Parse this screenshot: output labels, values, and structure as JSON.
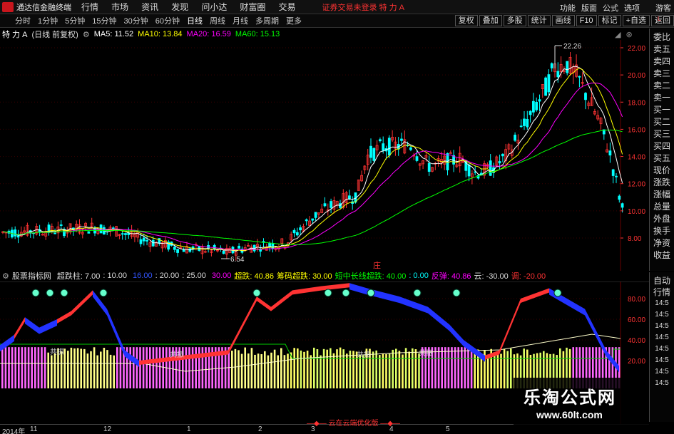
{
  "titlebar": {
    "app_title": "通达信金融终端",
    "menu": [
      "行情",
      "市场",
      "资讯",
      "发现",
      "问小达",
      "财富圈",
      "交易"
    ],
    "alert": "证券交易未登录 特 力 A",
    "right": [
      "功能",
      "版面",
      "公式",
      "选项",
      "游客"
    ]
  },
  "tabbar": {
    "tabs": [
      "分时",
      "1分钟",
      "5分钟",
      "15分钟",
      "30分钟",
      "60分钟",
      "日线",
      "周线",
      "月线",
      "多周期",
      "更多"
    ],
    "active": "日线",
    "right": [
      "复权",
      "叠加",
      "多股",
      "统计",
      "画线",
      "F10",
      "标记",
      "+自选",
      "返回"
    ]
  },
  "infobar": {
    "stock": "特 力 A",
    "mode": "(日线 前复权)",
    "ma5": "MA5: 11.52",
    "ma10": "MA10: 13.84",
    "ma20": "MA20: 16.59",
    "ma60": "MA60: 15.13"
  },
  "colors": {
    "ma5": "#ffffff",
    "ma10": "#ffff00",
    "ma20": "#ff00ff",
    "ma60": "#00ff00",
    "up": "#ff3333",
    "down": "#00ffff",
    "axis": "#ff3333"
  },
  "price_axis": [
    "22.00",
    "20.00",
    "18.00",
    "16.00",
    "14.00",
    "12.00",
    "10.00",
    "8.00"
  ],
  "price_annotations": {
    "high": "22.26",
    "low": "6.54",
    "marker": "庄"
  },
  "right_panel": [
    "委比",
    "卖五",
    "卖四",
    "卖三",
    "卖二",
    "卖一",
    "买一",
    "买二",
    "买三",
    "买四",
    "买五",
    "现价",
    "涨跌",
    "涨幅",
    "总量",
    "外盘",
    "换手",
    "净资",
    "收益"
  ],
  "right_panel2": {
    "header1": "自动",
    "header2": "行情",
    "times": [
      "14:5",
      "14:5",
      "14:5",
      "14:5",
      "14:5",
      "14:5",
      "14:5",
      "14:5"
    ]
  },
  "right_top_label": "L",
  "subinfo": {
    "name": "股票指标网",
    "items": [
      {
        "text": "超跌柱: 7.00",
        "color": "#dddddd"
      },
      {
        "text": ": 10.00",
        "color": "#dddddd"
      },
      {
        "text": "16.00",
        "color": "#3355ff"
      },
      {
        "text": ": 20.00",
        "color": "#dddddd"
      },
      {
        "text": ": 25.00",
        "color": "#dddddd"
      },
      {
        "text": "30.00",
        "color": "#ff00ff"
      },
      {
        "text": "超跌: 40.86",
        "color": "#ffff00"
      },
      {
        "text": "筹码超跌: 30.00",
        "color": "#ffff00"
      },
      {
        "text": "短中长线超跌: 40.00",
        "color": "#00ff00"
      },
      {
        "text": ": 0.00",
        "color": "#00ffff"
      },
      {
        "text": "反弹: 40.86",
        "color": "#ff00ff"
      },
      {
        "text": "云: -30.00",
        "color": "#dddddd"
      },
      {
        "text": "调: -20.00",
        "color": "#ff3333"
      }
    ]
  },
  "sub_axis": [
    "80.00",
    "60.00",
    "40.00",
    "20.00"
  ],
  "sub_annotations": [
    "共振",
    "共振",
    "共振",
    "共振"
  ],
  "timebar": {
    "labels": [
      "2014年",
      "11",
      "12",
      "1",
      "2",
      "3",
      "4",
      "5"
    ],
    "center": "云在云端优化版"
  },
  "watermark": {
    "cn": "乐淘公式网",
    "url": "www.60lt.com"
  }
}
